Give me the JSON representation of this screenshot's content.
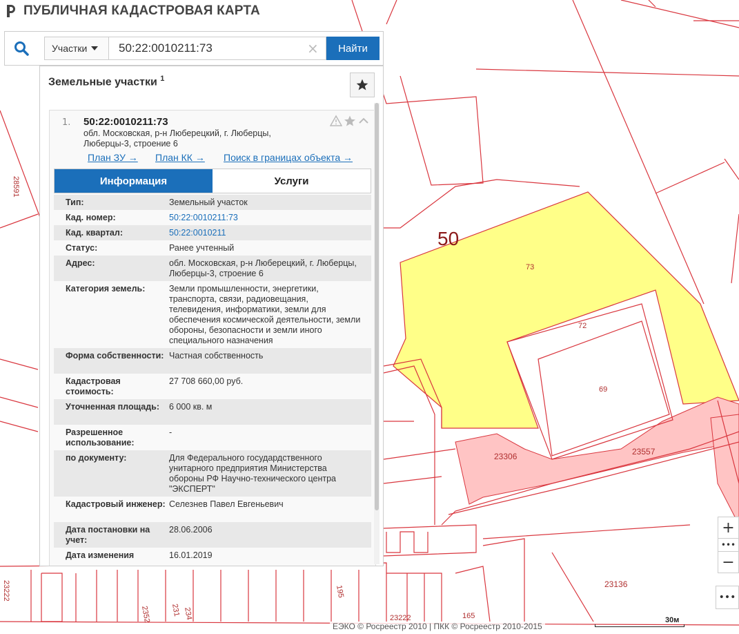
{
  "header": {
    "title": "ПУБЛИЧНАЯ КАДАСТРОВАЯ КАРТА"
  },
  "search": {
    "type_label": "Участки",
    "query": "50:22:0010211:73",
    "clear_symbol": "×",
    "find_label": "Найти"
  },
  "panel": {
    "title": "Земельные участки",
    "count": "1",
    "result": {
      "number": "1.",
      "cadastral_number": "50:22:0010211:73",
      "address_line1": "обл. Московская, р-н Люберецкий, г. Люберцы,",
      "address_line2": "Люберцы-3, строение 6"
    },
    "links": {
      "plan_zu": "План ЗУ →",
      "plan_kk": "План КК →",
      "search_bounds": "Поиск в границах объекта →"
    },
    "tabs": {
      "info": "Информация",
      "services": "Услуги"
    },
    "rows": [
      {
        "label": "Тип:",
        "value": "Земельный участок"
      },
      {
        "label": "Кад. номер:",
        "value": "50:22:0010211:73",
        "link": true
      },
      {
        "label": "Кад. квартал:",
        "value": "50:22:0010211",
        "link": true
      },
      {
        "label": "Статус:",
        "value": "Ранее учтенный"
      },
      {
        "label": "Адрес:",
        "value": "обл. Московская, р-н Люберецкий, г. Люберцы, Люберцы-3, строение 6"
      },
      {
        "label": "Категория земель:",
        "value": "Земли промышленности, энергетики, транспорта, связи, радиовещания, телевидения, информатики, земли для обеспечения космической деятельности, земли обороны, безопасности и земли иного специального назначения"
      },
      {
        "label": "Форма собственности:",
        "value": "Частная собственность"
      },
      {
        "label": "Кадастровая стоимость:",
        "value": "27 708 660,00 руб."
      },
      {
        "label": "Уточненная площадь:",
        "value": "6 000 кв. м"
      },
      {
        "label": "Разрешенное использование:",
        "value": "-"
      },
      {
        "label": "по документу:",
        "value": "Для Федерального государдственного унитарного предприятия Министерства обороны РФ Научно-технического центра \"ЭКСПЕРТ\""
      },
      {
        "label": "Кадастровый инженер:",
        "value": "Селезнев Павел Евгеньевич"
      },
      {
        "label": "Дата постановки на учет:",
        "value": "28.06.2006"
      },
      {
        "label": "Дата изменения",
        "value": "16.01.2019"
      }
    ]
  },
  "map": {
    "labels": {
      "region": "50",
      "p73": "73",
      "p72": "72",
      "p69": "69",
      "p23306": "23306",
      "p23557": "23557",
      "p23136": "23136",
      "p28591": "28591",
      "p23222": "23222",
      "p165": "165",
      "p195": "195",
      "p2352": "2352",
      "p231": "231",
      "p234": "234",
      "p2322": "23222"
    },
    "colors": {
      "line": "#d9363e",
      "selected_fill": "#ffff88",
      "zone_fill": "#ffc4c4"
    }
  },
  "controls": {
    "zoom_in": "+",
    "zoom_out": "−",
    "dots": "•••",
    "more": "•••"
  },
  "footer": {
    "attribution": "ЕЭКО © Росреестр 2010 | ПКК © Росреестр 2010-2015",
    "scale": "30м"
  }
}
